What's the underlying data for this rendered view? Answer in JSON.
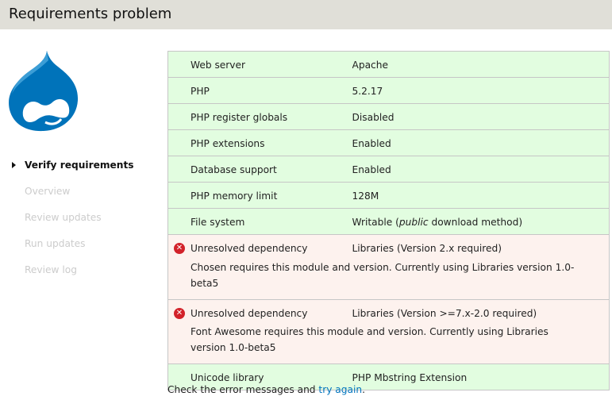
{
  "header": {
    "title": "Requirements problem"
  },
  "steps": [
    "Verify requirements",
    "Overview",
    "Review updates",
    "Run updates",
    "Review log"
  ],
  "requirements": [
    {
      "label": "Web server",
      "value": "Apache",
      "status": "ok"
    },
    {
      "label": "PHP",
      "value": "5.2.17",
      "status": "ok"
    },
    {
      "label": "PHP register globals",
      "value": "Disabled",
      "status": "ok"
    },
    {
      "label": "PHP extensions",
      "value": "Enabled",
      "status": "ok"
    },
    {
      "label": "Database support",
      "value": "Enabled",
      "status": "ok"
    },
    {
      "label": "PHP memory limit",
      "value": "128M",
      "status": "ok"
    },
    {
      "label": "File system",
      "value_pre": "Writable (",
      "value_em": "public",
      "value_post": " download method)",
      "status": "ok"
    },
    {
      "label": "Unresolved dependency",
      "value": "Libraries (Version 2.x required)",
      "description": "Chosen requires this module and version. Currently using Libraries version 1.0-beta5",
      "status": "error"
    },
    {
      "label": "Unresolved dependency",
      "value": "Libraries (Version >=7.x-2.0 required)",
      "description": "Font Awesome requires this module and version. Currently using Libraries version 1.0-beta5",
      "status": "error"
    },
    {
      "label": "Unicode library",
      "value": "PHP Mbstring Extension",
      "status": "ok"
    }
  ],
  "footer": {
    "text": "Check the error messages and ",
    "link": "try again",
    "end": "."
  }
}
